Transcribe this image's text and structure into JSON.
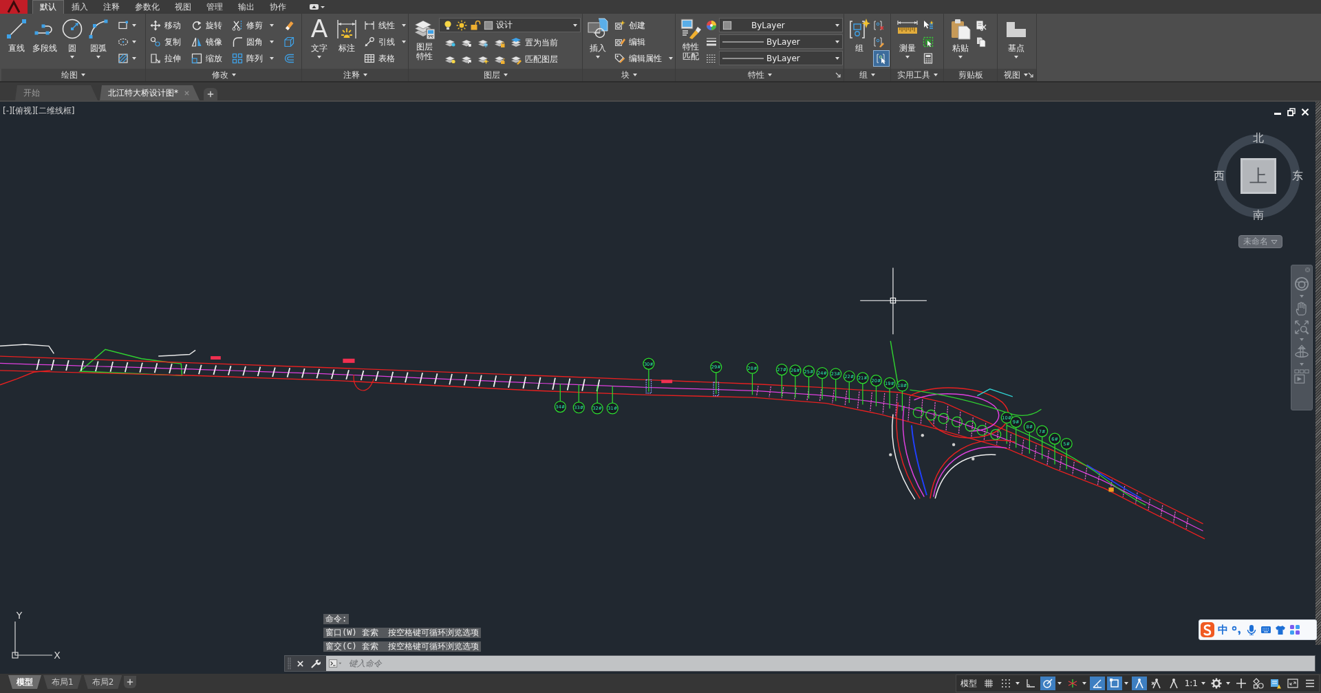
{
  "ribbon_tabs": [
    {
      "label": "默认",
      "selected": true
    },
    {
      "label": "插入",
      "selected": false
    },
    {
      "label": "注释",
      "selected": false
    },
    {
      "label": "参数化",
      "selected": false
    },
    {
      "label": "视图",
      "selected": false
    },
    {
      "label": "管理",
      "selected": false
    },
    {
      "label": "输出",
      "selected": false
    },
    {
      "label": "协作",
      "selected": false
    }
  ],
  "ribbon": {
    "draw": {
      "title": "绘图",
      "buttons": [
        "直线",
        "多段线",
        "圆",
        "圆弧"
      ]
    },
    "modify": {
      "title": "修改",
      "buttons": [
        "移动",
        "旋转",
        "修剪",
        "复制",
        "镜像",
        "圆角",
        "拉伸",
        "缩放",
        "阵列"
      ]
    },
    "annotation": {
      "title": "注释",
      "text_glyph": "A",
      "buttons": [
        "文字",
        "标注",
        "线性",
        "引线",
        "表格"
      ]
    },
    "layers": {
      "title": "图层",
      "buttons": [
        "图层特性",
        "置为当前",
        "匹配图层"
      ],
      "current_layer": "设计"
    },
    "block": {
      "title": "块",
      "buttons": [
        "插入",
        "创建",
        "编辑",
        "编辑属性"
      ]
    },
    "properties": {
      "title": "特性",
      "buttons": [
        "特性匹配"
      ],
      "color_setting": "ByLayer",
      "lineweight": "ByLayer",
      "linetype": "ByLayer"
    },
    "groups": {
      "title": "组",
      "buttons": [
        "组"
      ],
      "group_selection_on": true
    },
    "utilities": {
      "title": "实用工具",
      "buttons": [
        "测量"
      ]
    },
    "clipboard": {
      "title": "剪贴板",
      "buttons": [
        "粘贴"
      ]
    },
    "view": {
      "title": "视图",
      "buttons": [
        "基点"
      ]
    }
  },
  "file_tabs": [
    {
      "label": "开始",
      "selected": false
    },
    {
      "label": "北江特大桥设计图*",
      "selected": true
    }
  ],
  "viewport_controls": [
    "[-]",
    "[俯视]",
    "[二维线框]"
  ],
  "viewcube": {
    "north": "北",
    "west": "西",
    "east": "东",
    "south": "南",
    "face": "上",
    "coordinate_system": "未命名"
  },
  "drawing": {
    "pier_labels": [
      "34#",
      "33#",
      "32#",
      "31#",
      "30#",
      "29#",
      "28#",
      "27#",
      "26#",
      "25#",
      "24#",
      "23#",
      "22#",
      "21#",
      "20#",
      "19#",
      "18#",
      "10#",
      "9#",
      "8#",
      "7#",
      "6#",
      "5#"
    ]
  },
  "ucs_icon": {
    "y_axis": "Y",
    "x_axis": "X"
  },
  "command_line": {
    "history": [
      "命令:",
      "窗口(W) 套索  按空格键可循环浏览选项",
      "窗交(C) 套索  按空格键可循环浏览选项"
    ],
    "placeholder": "键入命令"
  },
  "ime_toolbar": {
    "mode": "中"
  },
  "layout_tabs": [
    {
      "label": "模型",
      "selected": true
    },
    {
      "label": "布局1",
      "selected": false
    },
    {
      "label": "布局2",
      "selected": false
    }
  ],
  "status_bar": {
    "model_label": "模型",
    "toggles": [
      {
        "on": false
      },
      {
        "on": false
      },
      {
        "on": false
      },
      {
        "on": true
      },
      {
        "on": false
      },
      {
        "on": true
      },
      {
        "on": true
      },
      {
        "on": true
      },
      {
        "on": false
      }
    ],
    "annotation_scale": "1:1"
  }
}
